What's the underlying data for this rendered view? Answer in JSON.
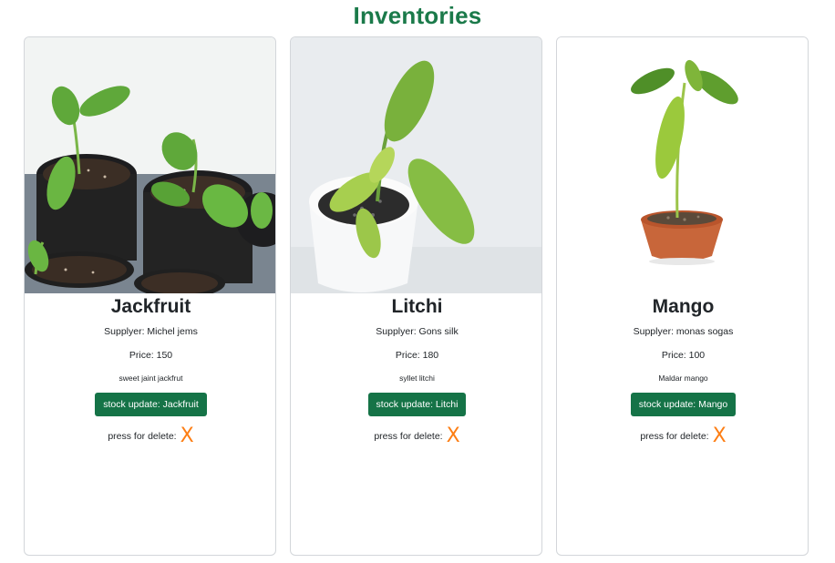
{
  "page": {
    "title": "Inventories"
  },
  "items": [
    {
      "name": "Jackfruit",
      "supplier": "Supplyer: Michel jems",
      "price": "Price: 150",
      "description": "sweet jaint jackfrut",
      "update_label": "stock update: Jackfruit",
      "delete_label": "press for delete:",
      "delete_icon": "X"
    },
    {
      "name": "Litchi",
      "supplier": "Supplyer: Gons silk",
      "price": "Price: 180",
      "description": "syllet litchi",
      "update_label": "stock update: Litchi",
      "delete_label": "press for delete:",
      "delete_icon": "X"
    },
    {
      "name": "Mango",
      "supplier": "Supplyer: monas sogas",
      "price": "Price: 100",
      "description": "Maldar mango",
      "update_label": "stock update: Mango",
      "delete_label": "press for delete:",
      "delete_icon": "X"
    }
  ],
  "colors": {
    "title": "#1b7a4a",
    "button": "#157347",
    "delete_icon": "#fd7e14"
  }
}
